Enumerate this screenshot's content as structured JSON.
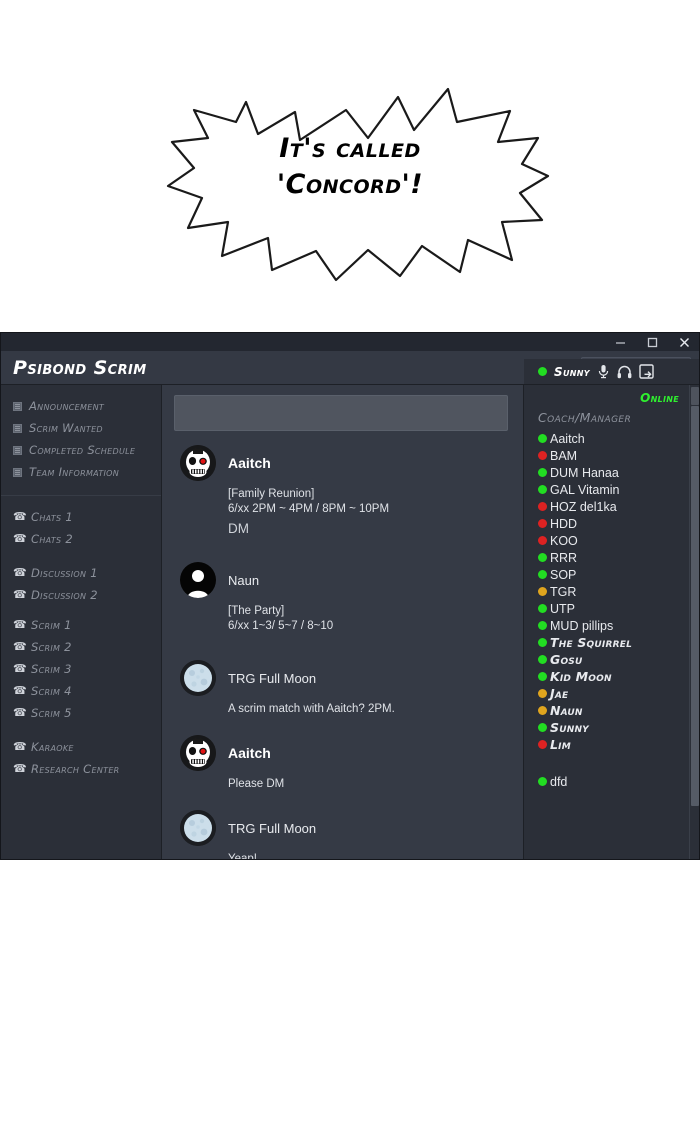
{
  "comic": {
    "line1": "It's called",
    "line2": "'Concord'!"
  },
  "window": {
    "minimize_label": "–",
    "maximize_label": "□",
    "close_label": "✕"
  },
  "header": {
    "app_title": "Psibond Scrim",
    "search_value": "",
    "search_placeholder": ""
  },
  "sidebar": {
    "groups": [
      {
        "icon": "list-icon",
        "items": [
          {
            "label": "Announcement"
          },
          {
            "label": "Scrim Wanted"
          },
          {
            "label": "Completed Schedule"
          },
          {
            "label": "Team Information"
          }
        ]
      },
      {
        "icon": "phone-icon",
        "items": [
          {
            "label": "Chats 1"
          },
          {
            "label": "Chats 2"
          },
          {
            "label": "",
            "spacer": true
          },
          {
            "label": "Discussion 1"
          },
          {
            "label": "Discussion 2"
          }
        ]
      },
      {
        "icon": "phone-icon",
        "items": [
          {
            "label": "Scrim 1"
          },
          {
            "label": "Scrim 2"
          },
          {
            "label": "Scrim 3"
          },
          {
            "label": "Scrim 4"
          },
          {
            "label": "Scrim 5"
          },
          {
            "label": "",
            "spacer": true
          },
          {
            "label": "Karaoke"
          },
          {
            "label": "Research Center"
          }
        ]
      }
    ]
  },
  "chat": {
    "input_value": "",
    "input_placeholder": "",
    "messages": [
      {
        "author": "Aaitch",
        "avatar": "skull-avatar",
        "bold": true,
        "lines": [
          "[Family Reunion]",
          "6/xx 2PM ~ 4PM / 8PM ~ 10PM"
        ],
        "extra": "DM",
        "gap_after": true
      },
      {
        "author": "Naun",
        "avatar": "person-avatar",
        "bold": false,
        "lines": [
          "[The Party]",
          "6/xx 1~3/ 5~7 / 8~10"
        ],
        "extra": "",
        "gap_after": true
      },
      {
        "author": "TRG Full Moon",
        "avatar": "moon-avatar",
        "bold": false,
        "lines": [
          "A scrim match with Aaitch? 2PM."
        ],
        "extra": "",
        "gap_after": false
      },
      {
        "author": "Aaitch",
        "avatar": "skull-avatar",
        "bold": true,
        "lines": [
          "Please DM"
        ],
        "extra": "",
        "gap_after": false
      },
      {
        "author": "TRG Full Moon",
        "avatar": "moon-avatar",
        "bold": false,
        "lines": [
          "Yeap!"
        ],
        "extra": "",
        "gap_after": false
      }
    ]
  },
  "me": {
    "status_color": "#22dd22",
    "name": "Sunny",
    "mic_icon": "microphone-icon",
    "headphones_icon": "headphones-icon",
    "logout_icon": "logout-icon"
  },
  "members": {
    "online_label": "Online",
    "online_color": "#2ff02f",
    "group_label": "Coach/Manager",
    "status_colors": {
      "online": "#22dd22",
      "away": "#e0a51e",
      "busy": "#dd2222"
    },
    "list": [
      {
        "name": "Aaitch",
        "status": "online",
        "comic": false
      },
      {
        "name": "BAM",
        "status": "busy",
        "comic": false
      },
      {
        "name": "DUM Hanaa",
        "status": "online",
        "comic": false
      },
      {
        "name": "GAL Vitamin",
        "status": "online",
        "comic": false
      },
      {
        "name": "HOZ del1ka",
        "status": "busy",
        "comic": false
      },
      {
        "name": "HDD",
        "status": "busy",
        "comic": false
      },
      {
        "name": "KOO",
        "status": "busy",
        "comic": false
      },
      {
        "name": "RRR",
        "status": "online",
        "comic": false
      },
      {
        "name": "SOP",
        "status": "online",
        "comic": false
      },
      {
        "name": "TGR",
        "status": "away",
        "comic": false
      },
      {
        "name": "UTP",
        "status": "online",
        "comic": false
      },
      {
        "name": "MUD pillips",
        "status": "online",
        "comic": false
      },
      {
        "name": "The Squirrel",
        "status": "online",
        "comic": true
      },
      {
        "name": "Gosu",
        "status": "online",
        "comic": true
      },
      {
        "name": "Kid Moon",
        "status": "online",
        "comic": true
      },
      {
        "name": "Jae",
        "status": "away",
        "comic": true
      },
      {
        "name": "Naun",
        "status": "away",
        "comic": true
      },
      {
        "name": "Sunny",
        "status": "online",
        "comic": true
      },
      {
        "name": "Lim",
        "status": "busy",
        "comic": true
      }
    ],
    "trailing": [
      {
        "name": "dfd",
        "status": "online",
        "comic": false
      }
    ]
  }
}
